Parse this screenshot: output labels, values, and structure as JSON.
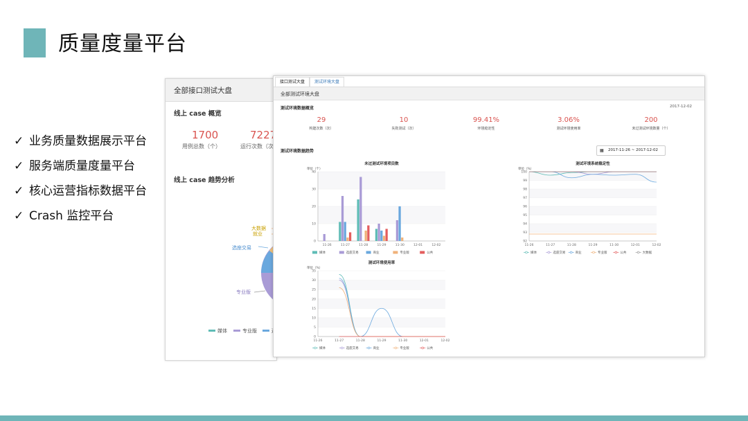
{
  "slide": {
    "title": "质量度量平台",
    "accent": "#6fb5b8",
    "check": "✓",
    "bullets": [
      "业务质量数据展示平台",
      "服务端质量度量平台",
      "核心运营指标数据平台",
      "Crash 监控平台"
    ]
  },
  "back_panel": {
    "header": "全部接口测试大盘",
    "overview_title": "线上 case 概览",
    "stats": [
      {
        "value": "1700",
        "label": "用例总数（个）"
      },
      {
        "value": "7227",
        "label": "运行次数（次）"
      }
    ],
    "trend_title": "线上 case 趋势分析",
    "pie_labels": [
      "大数据",
      "就业",
      "选座交易",
      "专业版"
    ],
    "legend": [
      "媒体",
      "专业版",
      "选"
    ]
  },
  "front_panel": {
    "tabs": [
      "接口测试大盘",
      "测试环境大盘"
    ],
    "header": "全部测试环境大盘",
    "overview_title": "测试环境数据概览",
    "date": "2017-12-02",
    "stats": [
      {
        "value": "29",
        "label": "构建次数（次）"
      },
      {
        "value": "10",
        "label": "失败测试（次）"
      },
      {
        "value": "99.41%",
        "label": "环境稳定性"
      },
      {
        "value": "3.06%",
        "label": "测试环境使用率"
      },
      {
        "value": "200",
        "label": "未过测试环境数量（个）"
      }
    ],
    "trend_title": "测试环境数据趋势",
    "date_range": "2017-11-26 ~ 2017-12-02",
    "calendar_icon": "calendar-icon"
  },
  "chart_data": [
    {
      "type": "bar",
      "title": "未过测试环境项目数",
      "ylabel": "单位（个）",
      "categories": [
        "11-26",
        "11-27",
        "11-28",
        "11-29",
        "11-30",
        "12-01",
        "12-02"
      ],
      "ylim": [
        0,
        40
      ],
      "yticks": [
        0,
        10,
        20,
        30,
        40
      ],
      "series": [
        {
          "name": "媒体",
          "color": "#5fbcb6",
          "values": [
            0,
            11,
            24,
            7,
            0,
            0,
            0
          ]
        },
        {
          "name": "选座交易",
          "color": "#a99bd6",
          "values": [
            4,
            26,
            37,
            10,
            12,
            0,
            0
          ]
        },
        {
          "name": "商业",
          "color": "#6aa8de",
          "values": [
            0,
            11,
            0,
            6,
            20,
            0,
            0
          ]
        },
        {
          "name": "专业版",
          "color": "#f0b27a",
          "values": [
            0,
            2,
            6,
            3,
            2,
            0,
            0
          ]
        },
        {
          "name": "公共",
          "color": "#e35d5d",
          "values": [
            0,
            5,
            9,
            7,
            0,
            0,
            0
          ]
        }
      ],
      "legend": "bottom"
    },
    {
      "type": "line",
      "title": "测试环境系统稳定性",
      "ylabel": "单位（%）",
      "categories": [
        "11-26",
        "11-27",
        "11-28",
        "11-29",
        "11-30",
        "12-01",
        "12-02"
      ],
      "ylim": [
        92,
        100
      ],
      "yticks": [
        92,
        93,
        94,
        95,
        96,
        97,
        98,
        99,
        100
      ],
      "series": [
        {
          "name": "媒体",
          "color": "#5fbcb6",
          "values": [
            100,
            99.6,
            99.9,
            100,
            100,
            100,
            100
          ]
        },
        {
          "name": "选座交易",
          "color": "#a99bd6",
          "values": [
            100,
            100,
            100,
            99.7,
            100,
            100,
            100
          ]
        },
        {
          "name": "商业",
          "color": "#6aa8de",
          "values": [
            100,
            100,
            99.3,
            99.7,
            99.6,
            99.7,
            98.8
          ]
        },
        {
          "name": "专业版",
          "color": "#f0b27a",
          "values": [
            92.8,
            92.8,
            92.8,
            92.8,
            92.8,
            92.8,
            92.8
          ]
        },
        {
          "name": "公共",
          "color": "#e35d5d",
          "values": [
            100,
            100,
            100,
            100,
            100,
            100,
            100
          ]
        },
        {
          "name": "大数据",
          "color": "#999999",
          "values": [
            100,
            100,
            100,
            100,
            100,
            100,
            100
          ]
        }
      ],
      "legend": "bottom"
    },
    {
      "type": "line",
      "title": "测试环境使用率",
      "ylabel": "单位（%）",
      "categories": [
        "11-26",
        "11-27",
        "11-28",
        "11-29",
        "11-30",
        "12-01",
        "12-02"
      ],
      "ylim": [
        0,
        35
      ],
      "yticks": [
        0,
        5,
        10,
        15,
        20,
        25,
        30,
        35
      ],
      "series": [
        {
          "name": "媒体",
          "color": "#5fbcb6",
          "values": [
            null,
            33,
            0,
            0,
            0,
            0,
            0
          ]
        },
        {
          "name": "选座交易",
          "color": "#a99bd6",
          "values": [
            null,
            30,
            0,
            0,
            0,
            0,
            0
          ]
        },
        {
          "name": "商业",
          "color": "#6aa8de",
          "values": [
            null,
            31,
            0,
            15,
            0,
            0,
            0
          ]
        },
        {
          "name": "专业版",
          "color": "#f0b27a",
          "values": [
            null,
            26,
            0,
            0,
            0,
            0,
            0
          ]
        },
        {
          "name": "公共",
          "color": "#e35d5d",
          "values": [
            null,
            0,
            0,
            0,
            0,
            0,
            0
          ]
        }
      ],
      "legend": "bottom"
    }
  ]
}
